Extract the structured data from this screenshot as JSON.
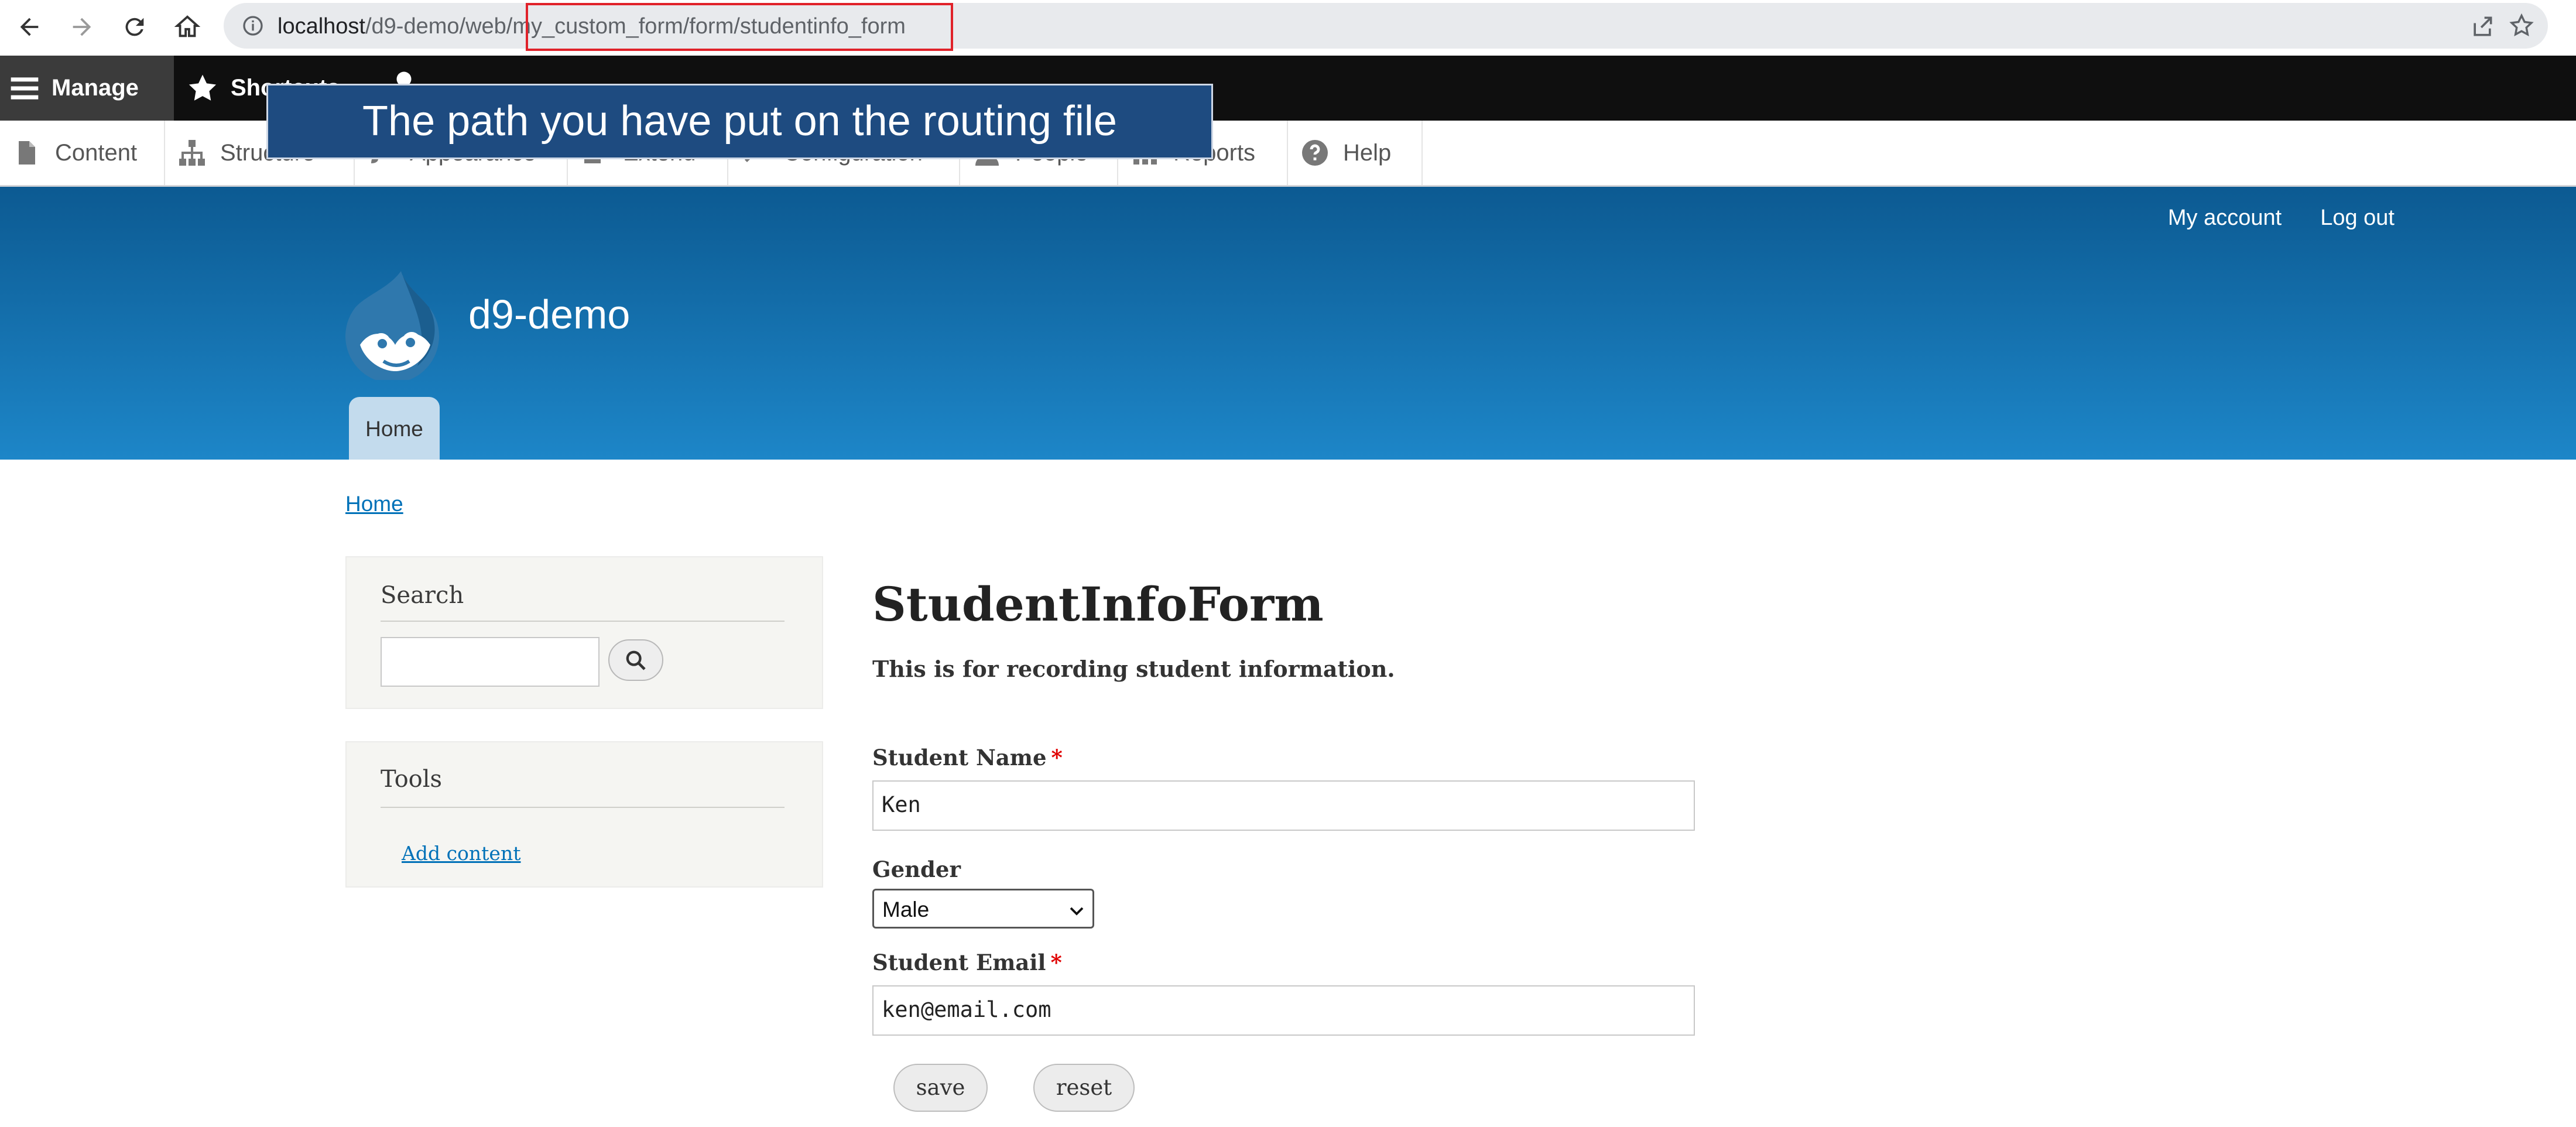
{
  "browser": {
    "url_host": "localhost",
    "url_path": "/d9-demo/web/my_custom_form/form/studentinfo_form",
    "url_path_prefix": "/d9-demo/web/",
    "url_path_highlighted": "my_custom_form/form/studentinfo_form",
    "highlight_color": "#e0222a"
  },
  "toolbar": {
    "manage_label": "Manage",
    "shortcuts_label": "Shortcuts",
    "tray_items": [
      {
        "label": "Content",
        "icon": "file-icon"
      },
      {
        "label": "Structure",
        "icon": "sitemap-icon"
      },
      {
        "label": "Appearance",
        "icon": "brush-icon"
      },
      {
        "label": "Extend",
        "icon": "puzzle-icon"
      },
      {
        "label": "Configuration",
        "icon": "wrench-icon"
      },
      {
        "label": "People",
        "icon": "person-icon"
      },
      {
        "label": "Reports",
        "icon": "bar-chart-icon"
      },
      {
        "label": "Help",
        "icon": "help-icon"
      }
    ]
  },
  "callout": {
    "text": "The path you have put on the routing file",
    "background": "#1e4b80"
  },
  "header": {
    "secondary_menu": [
      "My account",
      "Log out"
    ],
    "site_name": "d9-demo",
    "main_tab": "Home",
    "gradient_top": "#0c5a92",
    "gradient_bottom": "#1d86c8"
  },
  "breadcrumb": "Home",
  "sidebar": {
    "search_title": "Search",
    "search_value": "",
    "tools_title": "Tools",
    "tools_link": "Add content"
  },
  "form": {
    "title": "StudentInfoForm",
    "description": "This is for recording student information.",
    "name_label": "Student Name",
    "name_value": "Ken",
    "gender_label": "Gender",
    "gender_value": "Male",
    "email_label": "Student Email",
    "email_value": "ken@email.com",
    "required_marker": "*",
    "save_label": "save",
    "reset_label": "reset"
  }
}
